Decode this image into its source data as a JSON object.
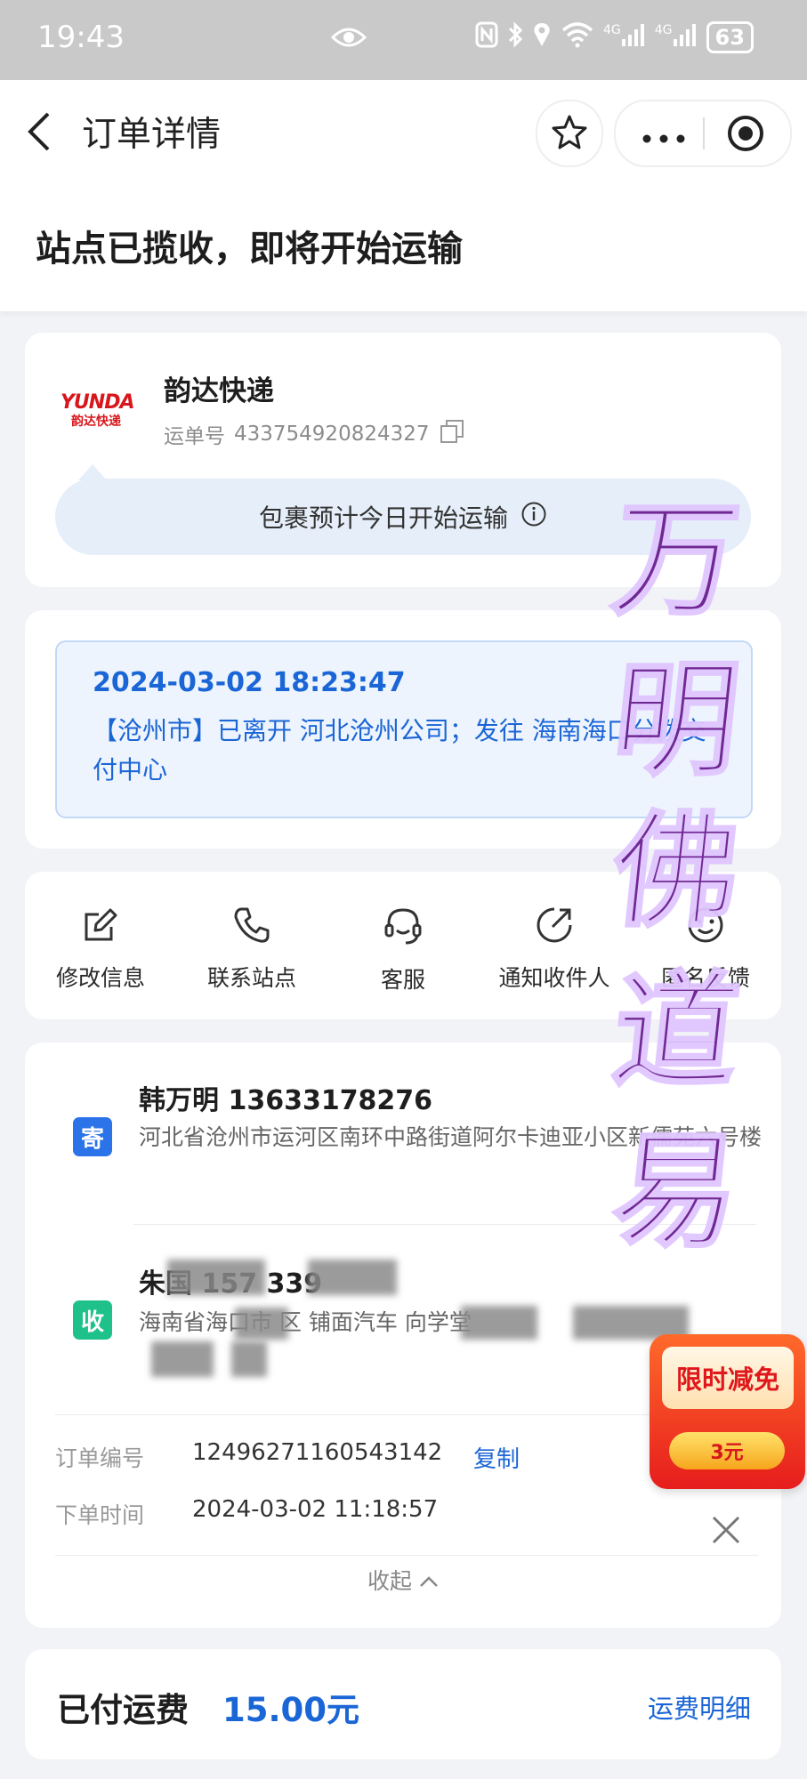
{
  "status_bar": {
    "time": "19:43",
    "network1": "4G",
    "network2": "4G",
    "battery": "63"
  },
  "nav": {
    "title": "订单详情"
  },
  "status_heading": "站点已揽收，即将开始运输",
  "carrier": {
    "logo_en": "YUNDA",
    "logo_cn": "韵达快递",
    "name": "韵达快递",
    "waybill_label": "运单号",
    "waybill_no": "433754920824327",
    "notice": "包裹预计今日开始运输"
  },
  "tracking": {
    "time": "2024-03-02 18:23:47",
    "text": "【沧州市】已离开 河北沧州公司；发往 海南海口分拨交付中心"
  },
  "actions": [
    {
      "label": "修改信息",
      "icon": "edit-icon"
    },
    {
      "label": "联系站点",
      "icon": "phone-icon"
    },
    {
      "label": "客服",
      "icon": "headset-icon"
    },
    {
      "label": "通知收件人",
      "icon": "share-icon"
    },
    {
      "label": "匿名反馈",
      "icon": "smile-icon"
    }
  ],
  "sender": {
    "tag": "寄",
    "name_phone": "韩万明 13633178276",
    "address": "河北省沧州市运河区南环中路街道阿尔卡迪亚小区新儒苑六号楼"
  },
  "receiver": {
    "tag": "收",
    "name_phone": "朱国 157 339",
    "address": "海南省海口市 区 铺面汽车 向学堂"
  },
  "order": {
    "no_label": "订单编号",
    "no": "12496271160543142",
    "copy": "复制",
    "time_label": "下单时间",
    "time": "2024-03-02 11:18:57",
    "collapse": "收起"
  },
  "fee": {
    "label": "已付运费",
    "amount": "15.00元",
    "detail": "运费明细"
  },
  "promo": {
    "title": "限时减免",
    "amount": "3元"
  },
  "watermark": [
    "万",
    "明",
    "佛",
    "道",
    "易"
  ],
  "colors": {
    "accent": "#1b66d6",
    "brand_red": "#d8161b",
    "send_tag": "#2b73e9",
    "recv_tag": "#1fc18a"
  }
}
